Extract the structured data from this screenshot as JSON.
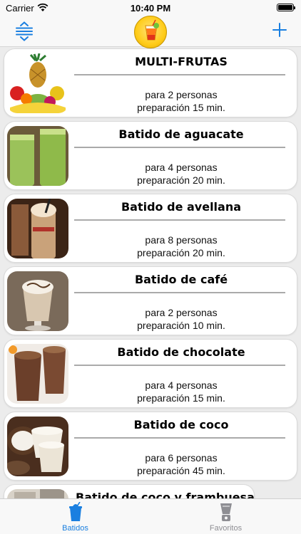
{
  "status_bar": {
    "carrier": "Carrier",
    "time": "10:40 PM"
  },
  "nav": {
    "left_icon": "sort-list-icon",
    "logo": "smoothie-glass-logo",
    "right_icon": "plus-icon",
    "accent_color": "#1a7fe0"
  },
  "recipes": [
    {
      "title": "MULTI-FRUTAS",
      "servings": "para 2 personas",
      "prep": "preparación 15 min.",
      "image": "fruit-basket-photo"
    },
    {
      "title": "Batido de aguacate",
      "servings": "para 4 personas",
      "prep": "preparación 20 min.",
      "image": "avocado-shake-photo"
    },
    {
      "title": "Batido de avellana",
      "servings": "para 8 personas",
      "prep": "preparación 20 min.",
      "image": "hazelnut-shake-photo"
    },
    {
      "title": "Batido de café",
      "servings": "para 2 personas",
      "prep": "preparación 10 min.",
      "image": "coffee-shake-photo"
    },
    {
      "title": "Batido de chocolate",
      "servings": "para 4 personas",
      "prep": "preparación 15 min.",
      "image": "chocolate-shake-photo"
    },
    {
      "title": "Batido de coco",
      "servings": "para 6 personas",
      "prep": "preparación 45 min.",
      "image": "coconut-shake-photo"
    },
    {
      "title": "Batido de coco y frambuesa",
      "servings": "",
      "prep": "",
      "image": "coconut-raspberry-shake-photo"
    }
  ],
  "tabs": [
    {
      "label": "Batidos",
      "icon": "cup-icon",
      "active": true
    },
    {
      "label": "Favoritos",
      "icon": "blender-icon",
      "active": false
    }
  ]
}
